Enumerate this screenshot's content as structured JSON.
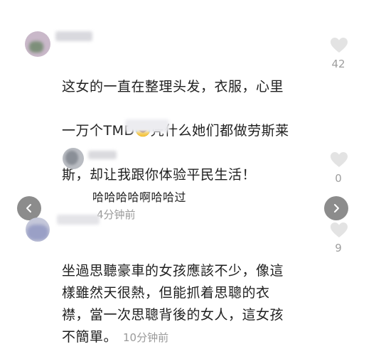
{
  "comments": [
    {
      "line1": "这女的一直在整理头发，衣服，心里",
      "line2_pre": "一万个TMD",
      "line2_post": "凭什么她们都做劳斯莱",
      "line3": "斯，却让我跟你体验平民生活！",
      "likes": "42"
    },
    {
      "text": "哈哈哈哈啊哈哈过",
      "time": "4分钟前",
      "likes": "0"
    },
    {
      "text": "坐過思聽豪車的女孩應該不少，像這\n樣雖然天很熱，但能抓着思聰的衣\n襟，當一次思聰背後的女人，這女孩\n不簡單。",
      "time": "10分钟前",
      "likes": "9"
    }
  ],
  "icons": {
    "like": "heart-outline-icon",
    "prev": "chevron-left-icon",
    "next": "chevron-right-icon",
    "emoji": "laughing-tears-emoji-icon"
  },
  "colors": {
    "text": "#1f1f1f",
    "muted": "#9a9a9a",
    "heart": "#dcdcdc",
    "nav": "#8c8c8c"
  }
}
